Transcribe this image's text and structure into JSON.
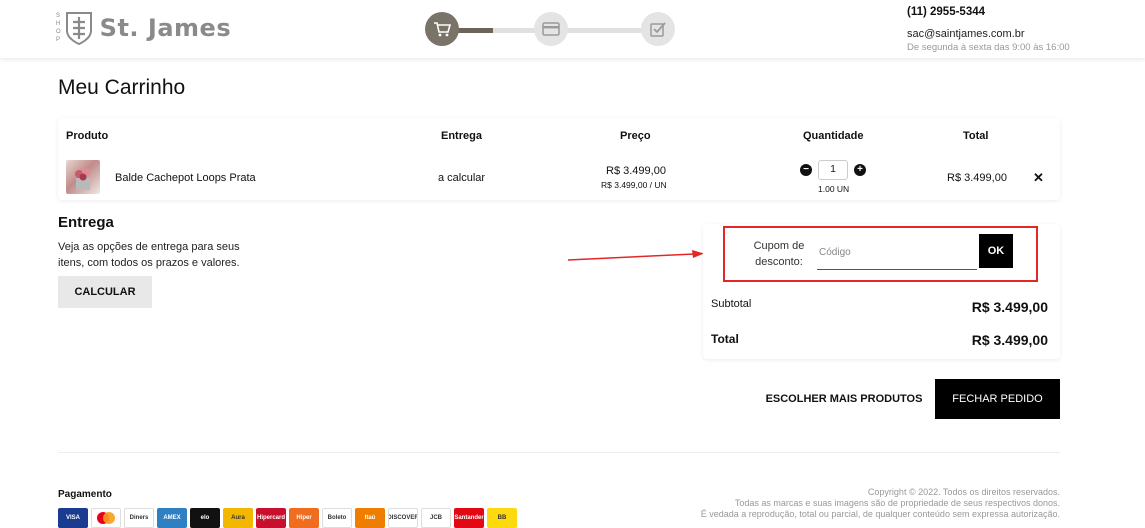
{
  "header": {
    "logo_shop": [
      "S",
      "H",
      "O",
      "P"
    ],
    "logo_text": "St. James",
    "phone": "(11) 2955-5344",
    "email": "sac@saintjames.com.br",
    "hours": "De segunda à sexta das 9:00 às 16:00",
    "steps": [
      {
        "icon": "cart-icon",
        "active": true
      },
      {
        "icon": "credit-card-icon",
        "active": false
      },
      {
        "icon": "check-box-icon",
        "active": false
      }
    ]
  },
  "page_title": "Meu Carrinho",
  "table": {
    "headers": {
      "product": "Produto",
      "delivery": "Entrega",
      "price": "Preço",
      "quantity": "Quantidade",
      "total": "Total"
    },
    "rows": [
      {
        "name": "Balde Cachepot Loops Prata",
        "delivery": "a calcular",
        "price": "R$ 3.499,00",
        "unit_price": "R$ 3.499,00 / UN",
        "quantity": "1",
        "quantity_unit": "1.00 UN",
        "total": "R$ 3.499,00"
      }
    ]
  },
  "entrega": {
    "title": "Entrega",
    "description": "Veja as opções de entrega para seus itens, com todos os prazos e valores.",
    "button": "CALCULAR"
  },
  "coupon": {
    "label": "Cupom de desconto:",
    "placeholder": "Código",
    "button": "OK"
  },
  "summary": {
    "subtotal_label": "Subtotal",
    "subtotal_value": "R$ 3.499,00",
    "total_label": "Total",
    "total_value": "R$ 3.499,00"
  },
  "actions": {
    "more_products": "ESCOLHER MAIS PRODUTOS",
    "checkout": "FECHAR PEDIDO"
  },
  "footer": {
    "payment_title": "Pagamento",
    "payment_methods": [
      {
        "label": "VISA",
        "color": "#1a3b8f"
      },
      {
        "label": "",
        "color": "#ffffff"
      },
      {
        "label": "Diners",
        "color": "#ffffff"
      },
      {
        "label": "AMEX",
        "color": "#2f7fc3"
      },
      {
        "label": "elo",
        "color": "#111111"
      },
      {
        "label": "Aura",
        "color": "#f3b700"
      },
      {
        "label": "Hipercard",
        "color": "#c8102e"
      },
      {
        "label": "Hiper",
        "color": "#f06c1f"
      },
      {
        "label": "Boleto",
        "color": "#ffffff"
      },
      {
        "label": "Itaú",
        "color": "#ef7d00"
      },
      {
        "label": "DISCOVER",
        "color": "#ffffff"
      },
      {
        "label": "JCB",
        "color": "#ffffff"
      },
      {
        "label": "Santander",
        "color": "#e30613"
      },
      {
        "label": "BB",
        "color": "#fdd90f"
      }
    ],
    "copyright": "Copyright © 2022. Todos os direitos reservados.",
    "rights_line1": "Todas as marcas e suas imagens são de propriedade de seus respectivos donos.",
    "rights_line2": "É vedada a reprodução, total ou parcial, de qualquer conteúdo sem expressa autorização."
  },
  "colors": {
    "accent_red": "#e32626",
    "step_active": "#7a7367",
    "button_dark": "#000000"
  }
}
